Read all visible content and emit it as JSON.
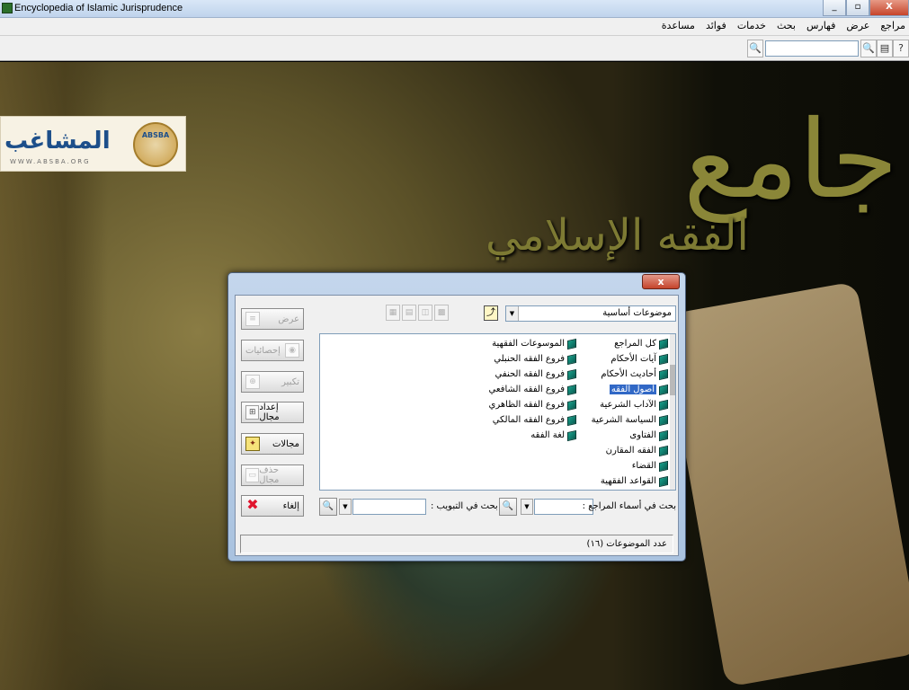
{
  "window": {
    "title": "Encyclopedia of Islamic Jurisprudence",
    "controls": {
      "minimize": "_",
      "restore": "▫",
      "close": "X"
    }
  },
  "menu": {
    "items": [
      "مراجع",
      "عرض",
      "فهارس",
      "بحث",
      "خدمات",
      "فوائد",
      "مساعدة"
    ]
  },
  "toolbar": {
    "search_value": "",
    "search_icon_glyph": "🔍",
    "book_icon_glyph": "▤",
    "help_icon_glyph": "?"
  },
  "background": {
    "calligraphy_main": "جامع",
    "calligraphy_sub": "الفقه الإسلامي",
    "logo_text": "المشاغب",
    "logo_subtext": "WWW.ABSBA.ORG",
    "logo_emblem": "ABSBA"
  },
  "dialog": {
    "close_label": "x",
    "buttons": {
      "view": "عرض",
      "stats": "إحصائيات",
      "zoom": "تكبير",
      "setup_field": "إعداد مجال",
      "fields": "مجالات",
      "delete_field": "حذف مجال",
      "cancel": "إلغاء"
    },
    "icon_glyphs": {
      "view": "≡",
      "stats": "◉",
      "zoom": "⊕",
      "setup_field": "⊞",
      "fields": "✦",
      "delete_field": "▭",
      "cancel": "✖",
      "nav": "⤴",
      "dropdown": "▼",
      "tool_1": "▦",
      "tool_2": "▤",
      "tool_3": "◫",
      "tool_4": "▩",
      "search": "🔍"
    },
    "category_combo": {
      "value": "موضوعات أساسية"
    },
    "list_col_a": [
      {
        "label": "كل المراجع",
        "selected": false
      },
      {
        "label": "آيات الأحكام",
        "selected": false
      },
      {
        "label": "أحاديث الأحكام",
        "selected": false
      },
      {
        "label": "أصول الفقه",
        "selected": true
      },
      {
        "label": "الآداب الشرعية",
        "selected": false
      },
      {
        "label": "السياسة الشرعية",
        "selected": false
      },
      {
        "label": "الفتاوى",
        "selected": false
      },
      {
        "label": "الفقه المقارن",
        "selected": false
      },
      {
        "label": "القضاء",
        "selected": false
      },
      {
        "label": "القواعد الفقهية",
        "selected": false
      }
    ],
    "list_col_b": [
      {
        "label": "الموسوعات الفقهية"
      },
      {
        "label": "فروع الفقه الحنبلي"
      },
      {
        "label": "فروع الفقه الحنفي"
      },
      {
        "label": "فروع الفقه الشافعي"
      },
      {
        "label": "فروع الفقه الظاهري"
      },
      {
        "label": "فروع الفقه المالكي"
      },
      {
        "label": "لغة الفقه"
      }
    ],
    "search": {
      "names_label": "بحث في أسماء المراجع :",
      "names_value": "",
      "chapters_label": "بحث في التبويب :",
      "chapters_value": ""
    },
    "status_text": "عدد الموضوعات (١٦)"
  }
}
